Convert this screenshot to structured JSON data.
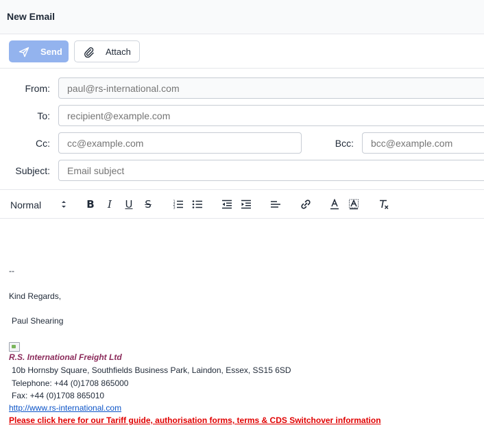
{
  "window": {
    "title": "New Email"
  },
  "actions": {
    "send_label": "Send",
    "attach_label": "Attach"
  },
  "fields": {
    "from": {
      "label": "From:",
      "placeholder": "paul@rs-international.com"
    },
    "to": {
      "label": "To:",
      "placeholder": "recipient@example.com"
    },
    "cc": {
      "label": "Cc:",
      "placeholder": "cc@example.com"
    },
    "bcc": {
      "label": "Bcc:",
      "placeholder": "bcc@example.com"
    },
    "subject": {
      "label": "Subject:",
      "placeholder": "Email subject"
    }
  },
  "toolbar": {
    "heading_select": "Normal",
    "bold": "B",
    "italic": "I",
    "underline": "U",
    "strike": "S"
  },
  "body": {
    "separator": "--",
    "regards": "Kind Regards,",
    "name": "Paul Shearing",
    "company": "R.S. International Freight Ltd",
    "address": "10b Hornsby Square, Southfields Business Park, Laindon, Essex, SS15 6SD",
    "telephone": "Telephone: +44 (0)1708 865000",
    "fax": "Fax: +44 (0)1708 865010",
    "website": "http://www.rs-international.com",
    "tariff_link": "Please click here for our Tariff guide, authorisation forms, terms & CDS Switchover information"
  },
  "colors": {
    "send_button": "#93b3ee",
    "company_name": "#8b2a5a",
    "link": "#0b53c7",
    "tariff_link": "#e00000"
  }
}
